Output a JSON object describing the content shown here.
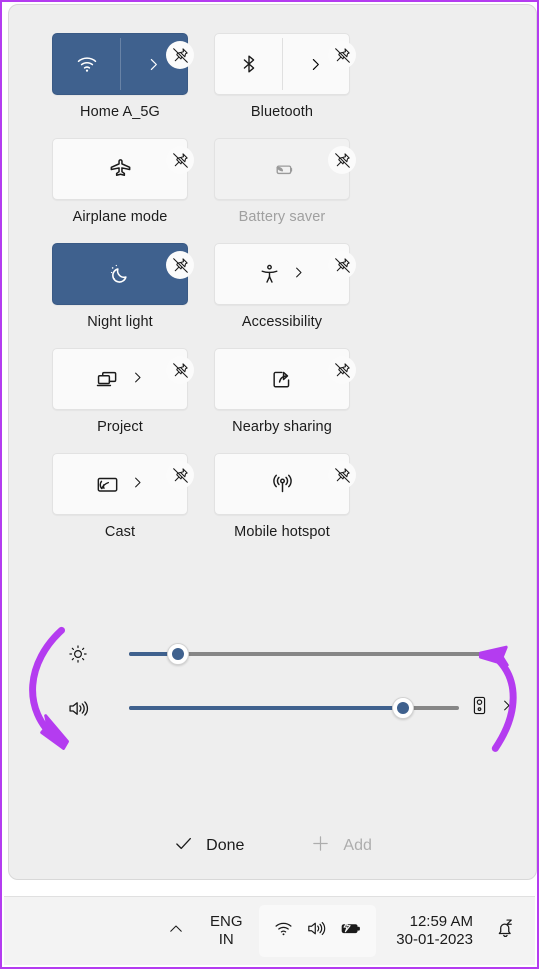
{
  "theme": {
    "accent": "#3f618e",
    "panel_bg": "#eeeeee",
    "tile_bg": "#fafafa",
    "annotation_color": "#b43cf0",
    "taskbar_bg": "#f3f3f3"
  },
  "panel": {
    "name": "quick-settings",
    "edit_mode": true
  },
  "tiles": [
    {
      "id": "wifi",
      "label": "Home A_5G",
      "icon": "wifi-icon",
      "state": "on",
      "split": true,
      "chevron": true,
      "unpin": "unpin-icon",
      "disabled": false
    },
    {
      "id": "bluetooth",
      "label": "Bluetooth",
      "icon": "bluetooth-icon",
      "state": "off",
      "split": true,
      "chevron": true,
      "unpin": "unpin-icon",
      "disabled": false
    },
    {
      "id": "airplane-mode",
      "label": "Airplane mode",
      "icon": "airplane-icon",
      "state": "off",
      "split": false,
      "chevron": false,
      "unpin": "unpin-icon",
      "disabled": false
    },
    {
      "id": "battery-saver",
      "label": "Battery saver",
      "icon": "battery-saver-icon",
      "state": "off",
      "split": false,
      "chevron": false,
      "unpin": "unpin-icon",
      "disabled": true
    },
    {
      "id": "night-light",
      "label": "Night light",
      "icon": "night-light-icon",
      "state": "on",
      "split": false,
      "chevron": false,
      "unpin": "unpin-icon",
      "disabled": false
    },
    {
      "id": "accessibility",
      "label": "Accessibility",
      "icon": "accessibility-icon",
      "state": "off",
      "split": false,
      "chevron": true,
      "unpin": "unpin-icon",
      "disabled": false
    },
    {
      "id": "project",
      "label": "Project",
      "icon": "project-icon",
      "state": "off",
      "split": false,
      "chevron": true,
      "unpin": "unpin-icon",
      "disabled": false
    },
    {
      "id": "nearby-sharing",
      "label": "Nearby sharing",
      "icon": "nearby-sharing-icon",
      "state": "off",
      "split": false,
      "chevron": false,
      "unpin": "unpin-icon",
      "disabled": false
    },
    {
      "id": "cast",
      "label": "Cast",
      "icon": "cast-icon",
      "state": "off",
      "split": false,
      "chevron": true,
      "unpin": "unpin-icon",
      "disabled": false
    },
    {
      "id": "mobile-hotspot",
      "label": "Mobile hotspot",
      "icon": "mobile-hotspot-icon",
      "state": "off",
      "split": false,
      "chevron": false,
      "unpin": "unpin-icon",
      "disabled": false
    }
  ],
  "sliders": [
    {
      "id": "brightness",
      "icon": "brightness-icon",
      "value": 13,
      "min": 0,
      "max": 100,
      "has_output_picker": false
    },
    {
      "id": "volume",
      "icon": "volume-icon",
      "value": 83,
      "min": 0,
      "max": 100,
      "has_output_picker": true,
      "output_icon": "speaker-icon",
      "output_chevron": "chevron-right-icon"
    }
  ],
  "footer": {
    "done_label": "Done",
    "done_icon": "check-icon",
    "add_label": "Add",
    "add_icon": "plus-icon",
    "add_disabled": true
  },
  "taskbar": {
    "show_hidden_icons_icon": "chevron-up-icon",
    "language": {
      "line1": "ENG",
      "line2": "IN"
    },
    "tray_icons": [
      "wifi-icon",
      "volume-icon",
      "battery-charging-icon"
    ],
    "clock": {
      "time": "12:59 AM",
      "date": "30-01-2023"
    },
    "notifications_icon": "bell-silent-icon"
  },
  "annotations": [
    {
      "id": "arrow-brightness-to-volume",
      "shape": "curved-arrow",
      "color": "#b43cf0",
      "points_to": "volume-icon"
    },
    {
      "id": "arrow-to-brightness-track-end",
      "shape": "curved-arrow",
      "color": "#b43cf0",
      "points_to": "brightness-slider-track"
    }
  ]
}
